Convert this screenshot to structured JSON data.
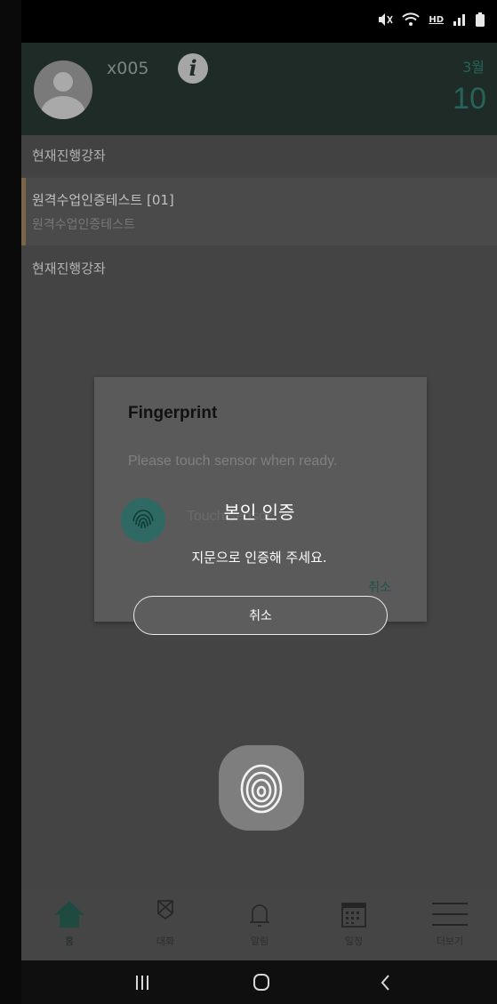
{
  "status_bar": {
    "icons": [
      "mute-icon",
      "wifi-icon",
      "hd-voice-icon",
      "signal-icon",
      "battery-icon"
    ],
    "hd": "HD"
  },
  "header": {
    "username": "x005",
    "month": "3월",
    "day": "10"
  },
  "sections": {
    "current_title_1": "현재진행강좌",
    "current_title_2": "현재진행강좌"
  },
  "course": {
    "title": "원격수업인증테스트 [01]",
    "subtitle": "원격수업인증테스트"
  },
  "fingerprint_dialog": {
    "title": "Fingerprint",
    "message": "Please touch sensor when ready.",
    "sensor_label": "Touch sensor",
    "cancel": "취소"
  },
  "auth_overlay": {
    "title": "본인 인증",
    "subtitle": "지문으로 인증해 주세요.",
    "cancel_button": "취소"
  },
  "bottom_nav": [
    {
      "label": "홈",
      "icon": "home-icon",
      "active": true
    },
    {
      "label": "대화",
      "icon": "chat-icon",
      "active": false
    },
    {
      "label": "알림",
      "icon": "bell-icon",
      "active": false
    },
    {
      "label": "일정",
      "icon": "calendar-icon",
      "active": false
    },
    {
      "label": "더보기",
      "icon": "menu-icon",
      "active": false
    }
  ],
  "system_nav": {
    "buttons": [
      "recents-icon",
      "home-button-icon",
      "back-icon"
    ]
  },
  "colors": {
    "header_bg": "#1e2b27",
    "accent": "#27635a",
    "overlay_bg": "#444444",
    "course_bar": "#7a6548"
  }
}
